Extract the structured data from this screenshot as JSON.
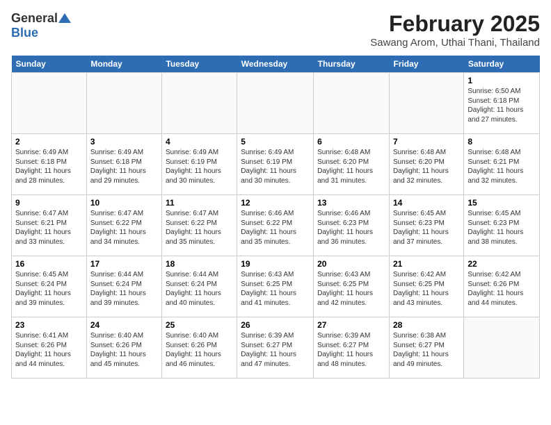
{
  "header": {
    "logo_general": "General",
    "logo_blue": "Blue",
    "title": "February 2025",
    "subtitle": "Sawang Arom, Uthai Thani, Thailand"
  },
  "weekdays": [
    "Sunday",
    "Monday",
    "Tuesday",
    "Wednesday",
    "Thursday",
    "Friday",
    "Saturday"
  ],
  "weeks": [
    [
      {
        "day": "",
        "info": ""
      },
      {
        "day": "",
        "info": ""
      },
      {
        "day": "",
        "info": ""
      },
      {
        "day": "",
        "info": ""
      },
      {
        "day": "",
        "info": ""
      },
      {
        "day": "",
        "info": ""
      },
      {
        "day": "1",
        "info": "Sunrise: 6:50 AM\nSunset: 6:18 PM\nDaylight: 11 hours and 27 minutes."
      }
    ],
    [
      {
        "day": "2",
        "info": "Sunrise: 6:49 AM\nSunset: 6:18 PM\nDaylight: 11 hours and 28 minutes."
      },
      {
        "day": "3",
        "info": "Sunrise: 6:49 AM\nSunset: 6:18 PM\nDaylight: 11 hours and 29 minutes."
      },
      {
        "day": "4",
        "info": "Sunrise: 6:49 AM\nSunset: 6:19 PM\nDaylight: 11 hours and 30 minutes."
      },
      {
        "day": "5",
        "info": "Sunrise: 6:49 AM\nSunset: 6:19 PM\nDaylight: 11 hours and 30 minutes."
      },
      {
        "day": "6",
        "info": "Sunrise: 6:48 AM\nSunset: 6:20 PM\nDaylight: 11 hours and 31 minutes."
      },
      {
        "day": "7",
        "info": "Sunrise: 6:48 AM\nSunset: 6:20 PM\nDaylight: 11 hours and 32 minutes."
      },
      {
        "day": "8",
        "info": "Sunrise: 6:48 AM\nSunset: 6:21 PM\nDaylight: 11 hours and 32 minutes."
      }
    ],
    [
      {
        "day": "9",
        "info": "Sunrise: 6:47 AM\nSunset: 6:21 PM\nDaylight: 11 hours and 33 minutes."
      },
      {
        "day": "10",
        "info": "Sunrise: 6:47 AM\nSunset: 6:22 PM\nDaylight: 11 hours and 34 minutes."
      },
      {
        "day": "11",
        "info": "Sunrise: 6:47 AM\nSunset: 6:22 PM\nDaylight: 11 hours and 35 minutes."
      },
      {
        "day": "12",
        "info": "Sunrise: 6:46 AM\nSunset: 6:22 PM\nDaylight: 11 hours and 35 minutes."
      },
      {
        "day": "13",
        "info": "Sunrise: 6:46 AM\nSunset: 6:23 PM\nDaylight: 11 hours and 36 minutes."
      },
      {
        "day": "14",
        "info": "Sunrise: 6:45 AM\nSunset: 6:23 PM\nDaylight: 11 hours and 37 minutes."
      },
      {
        "day": "15",
        "info": "Sunrise: 6:45 AM\nSunset: 6:23 PM\nDaylight: 11 hours and 38 minutes."
      }
    ],
    [
      {
        "day": "16",
        "info": "Sunrise: 6:45 AM\nSunset: 6:24 PM\nDaylight: 11 hours and 39 minutes."
      },
      {
        "day": "17",
        "info": "Sunrise: 6:44 AM\nSunset: 6:24 PM\nDaylight: 11 hours and 39 minutes."
      },
      {
        "day": "18",
        "info": "Sunrise: 6:44 AM\nSunset: 6:24 PM\nDaylight: 11 hours and 40 minutes."
      },
      {
        "day": "19",
        "info": "Sunrise: 6:43 AM\nSunset: 6:25 PM\nDaylight: 11 hours and 41 minutes."
      },
      {
        "day": "20",
        "info": "Sunrise: 6:43 AM\nSunset: 6:25 PM\nDaylight: 11 hours and 42 minutes."
      },
      {
        "day": "21",
        "info": "Sunrise: 6:42 AM\nSunset: 6:25 PM\nDaylight: 11 hours and 43 minutes."
      },
      {
        "day": "22",
        "info": "Sunrise: 6:42 AM\nSunset: 6:26 PM\nDaylight: 11 hours and 44 minutes."
      }
    ],
    [
      {
        "day": "23",
        "info": "Sunrise: 6:41 AM\nSunset: 6:26 PM\nDaylight: 11 hours and 44 minutes."
      },
      {
        "day": "24",
        "info": "Sunrise: 6:40 AM\nSunset: 6:26 PM\nDaylight: 11 hours and 45 minutes."
      },
      {
        "day": "25",
        "info": "Sunrise: 6:40 AM\nSunset: 6:26 PM\nDaylight: 11 hours and 46 minutes."
      },
      {
        "day": "26",
        "info": "Sunrise: 6:39 AM\nSunset: 6:27 PM\nDaylight: 11 hours and 47 minutes."
      },
      {
        "day": "27",
        "info": "Sunrise: 6:39 AM\nSunset: 6:27 PM\nDaylight: 11 hours and 48 minutes."
      },
      {
        "day": "28",
        "info": "Sunrise: 6:38 AM\nSunset: 6:27 PM\nDaylight: 11 hours and 49 minutes."
      },
      {
        "day": "",
        "info": ""
      }
    ]
  ]
}
